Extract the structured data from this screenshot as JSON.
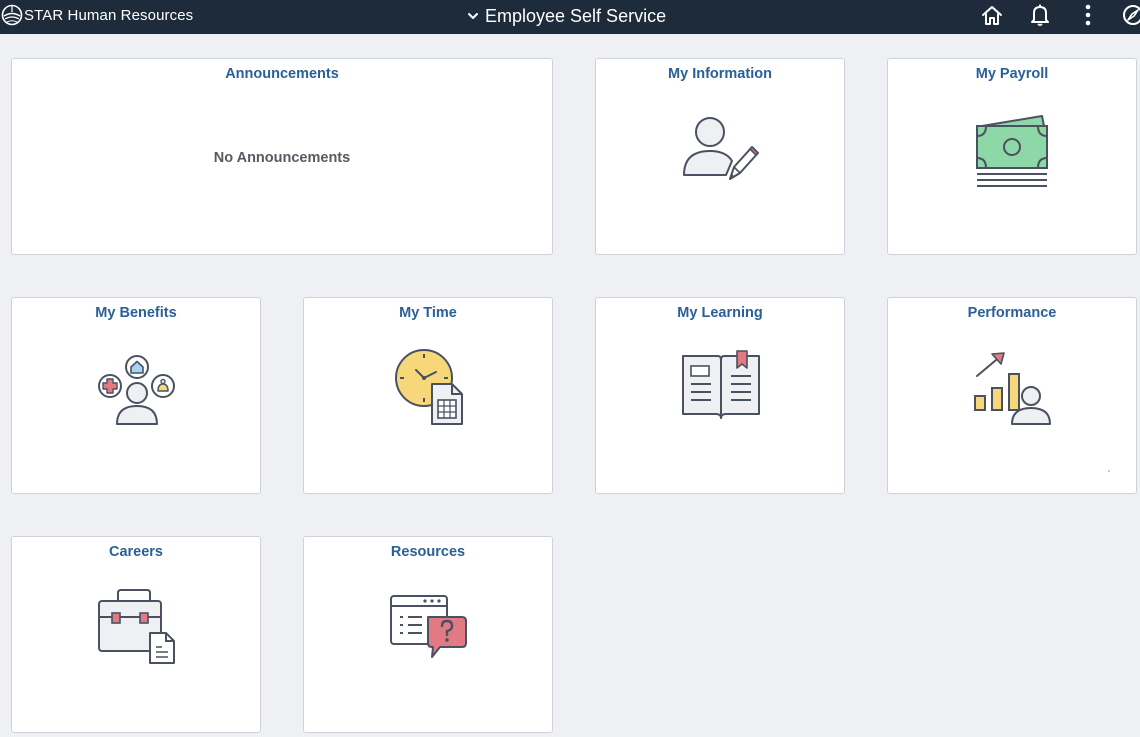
{
  "header": {
    "brand": "STAR Human Resources",
    "title": "Employee Self Service",
    "icons": {
      "logo": "globe-logo",
      "switch": "chevron-down-icon",
      "home": "home-icon",
      "notifications": "bell-icon",
      "actions": "vertical-ellipsis-icon",
      "navbar": "compass-icon"
    }
  },
  "tiles": {
    "announcements": {
      "title": "Announcements",
      "message": "No Announcements"
    },
    "my_information": {
      "title": "My Information",
      "icon": "person-pencil-icon"
    },
    "my_payroll": {
      "title": "My Payroll",
      "icon": "money-icon"
    },
    "my_benefits": {
      "title": "My Benefits",
      "icon": "benefits-icon"
    },
    "my_time": {
      "title": "My Time",
      "icon": "clock-timesheet-icon"
    },
    "my_learning": {
      "title": "My Learning",
      "icon": "open-book-icon"
    },
    "performance": {
      "title": "Performance",
      "icon": "growth-chart-icon"
    },
    "careers": {
      "title": "Careers",
      "icon": "briefcase-document-icon"
    },
    "resources": {
      "title": "Resources",
      "icon": "window-help-icon"
    }
  },
  "colors": {
    "header_bg": "#1d2b3a",
    "page_bg": "#eef0f3",
    "tile_title": "#2a5f98",
    "icon_stroke": "#4a5160",
    "payroll_green": "#8ed8a8",
    "clock_yellow": "#f6d77a",
    "accent_red": "#e27a83",
    "soft_blue": "#a6d5ef"
  }
}
